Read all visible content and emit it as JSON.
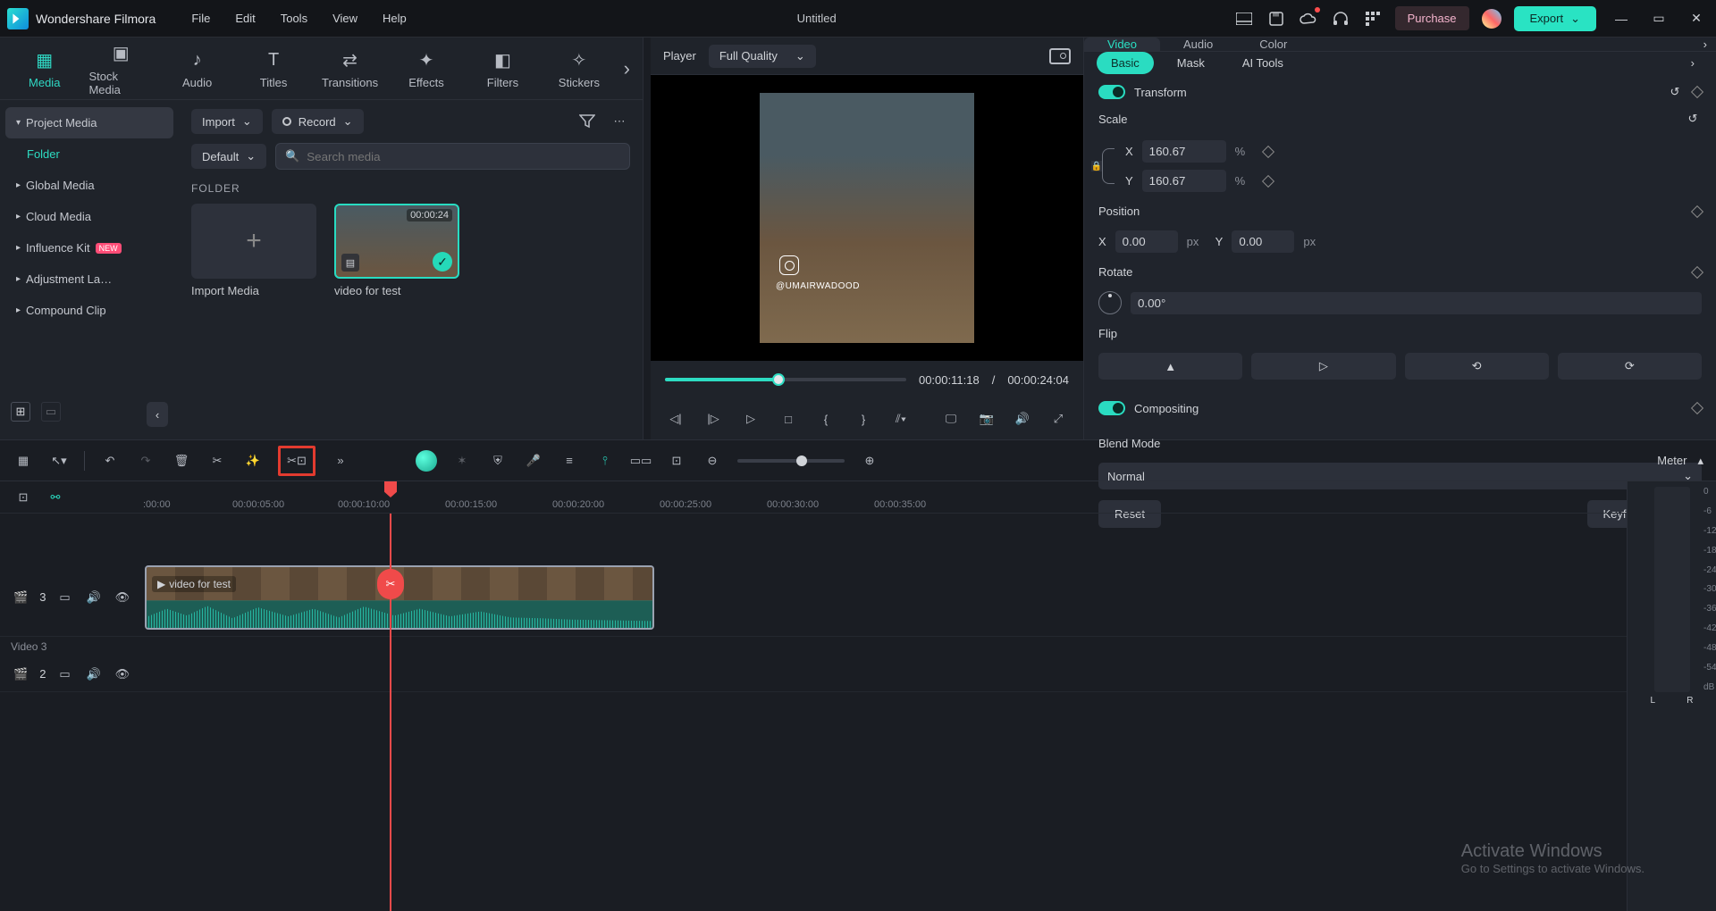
{
  "app_name": "Wondershare Filmora",
  "menubar": [
    "File",
    "Edit",
    "Tools",
    "View",
    "Help"
  ],
  "doc_title": "Untitled",
  "purchase": "Purchase",
  "export": "Export",
  "mode_tabs": [
    {
      "icon": "▦",
      "label": "Media"
    },
    {
      "icon": "▣",
      "label": "Stock Media"
    },
    {
      "icon": "♪",
      "label": "Audio"
    },
    {
      "icon": "T",
      "label": "Titles"
    },
    {
      "icon": "⇄",
      "label": "Transitions"
    },
    {
      "icon": "✦",
      "label": "Effects"
    },
    {
      "icon": "◧",
      "label": "Filters"
    },
    {
      "icon": "✧",
      "label": "Stickers"
    }
  ],
  "tree": {
    "project_media": "Project Media",
    "folder": "Folder",
    "global_media": "Global Media",
    "cloud_media": "Cloud Media",
    "influence_kit": "Influence Kit",
    "new": "NEW",
    "adjustment": "Adjustment La…",
    "compound": "Compound Clip"
  },
  "media_content": {
    "import": "Import",
    "record": "Record",
    "default": "Default",
    "search_placeholder": "Search media",
    "folder_label": "FOLDER",
    "import_media": "Import Media",
    "clip_name": "video for test",
    "clip_dur": "00:00:24"
  },
  "player": {
    "label": "Player",
    "quality": "Full Quality",
    "ig_user": "@UMAIRWADOOD",
    "cur_time": "00:00:11:18",
    "sep": "/",
    "total_time": "00:00:24:04"
  },
  "inspector": {
    "tabs": [
      "Video",
      "Audio",
      "Color"
    ],
    "subtabs": [
      "Basic",
      "Mask",
      "AI Tools"
    ],
    "transform": "Transform",
    "scale": "Scale",
    "x": "X",
    "y": "Y",
    "scale_x": "160.67",
    "scale_y": "160.67",
    "pct": "%",
    "position": "Position",
    "pos_x": "0.00",
    "pos_y": "0.00",
    "px": "px",
    "rotate": "Rotate",
    "rotate_val": "0.00°",
    "flip": "Flip",
    "compositing": "Compositing",
    "blend_mode": "Blend Mode",
    "blend_value": "Normal",
    "reset": "Reset",
    "keyframe": "Keyframe Panel"
  },
  "timeline": {
    "ruler": [
      ":00:00",
      "00:00:05:00",
      "00:00:10:00",
      "00:00:15:00",
      "00:00:20:00",
      "00:00:25:00",
      "00:00:30:00",
      "00:00:35:00"
    ],
    "meter": "Meter",
    "db": [
      "0",
      "-6",
      "-12",
      "-18",
      "-24",
      "-30",
      "-36",
      "-42",
      "-48",
      "-54",
      "dB"
    ],
    "L": "L",
    "R": "R",
    "track3": "3",
    "track3_name": "Video 3",
    "track2": "2",
    "clip_name": "video for test"
  },
  "watermark": {
    "h": "Activate Windows",
    "s": "Go to Settings to activate Windows."
  }
}
